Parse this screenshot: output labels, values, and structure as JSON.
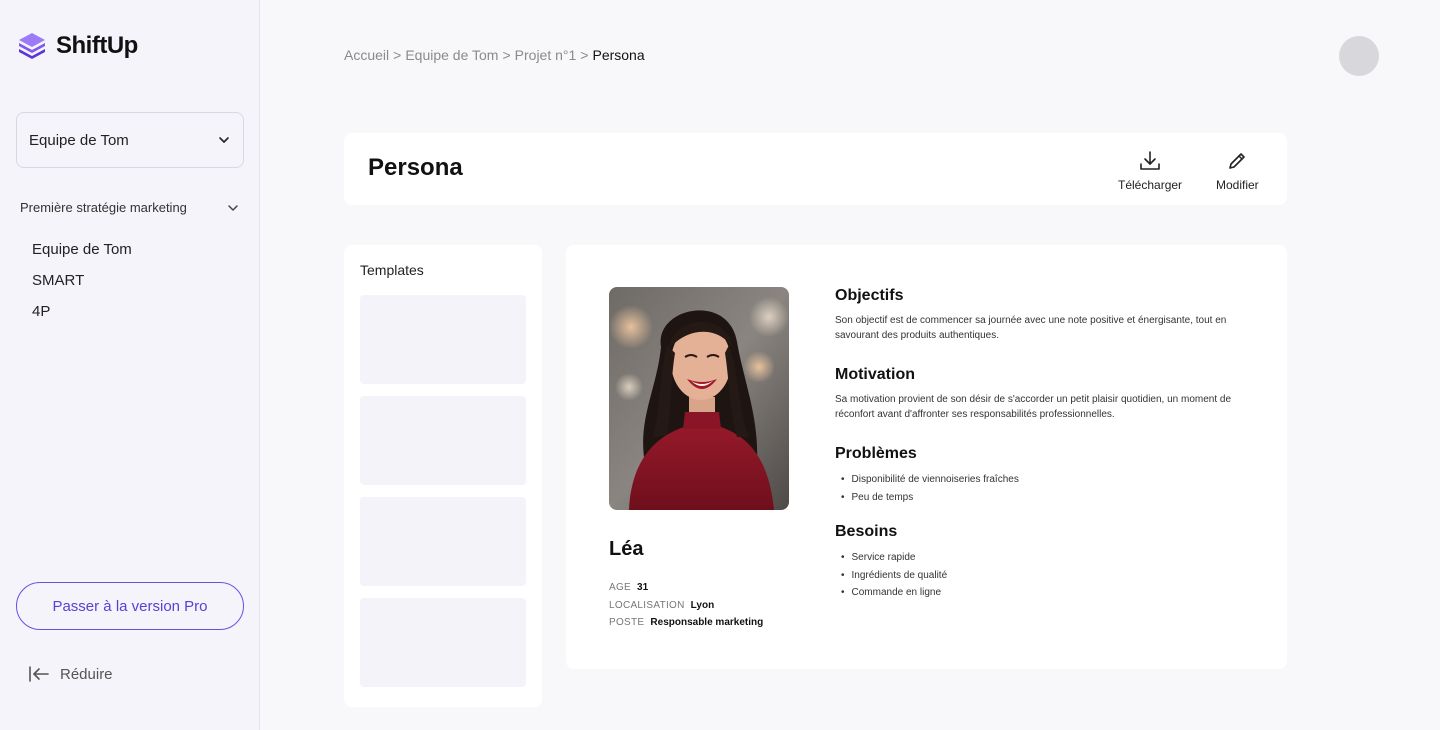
{
  "app": {
    "name": "ShiftUp"
  },
  "sidebar": {
    "team_select": "Equipe de Tom",
    "strategy": "Première stratégie marketing",
    "items": [
      {
        "label": "Equipe de Tom"
      },
      {
        "label": "SMART"
      },
      {
        "label": "4P"
      }
    ],
    "pro_button": "Passer à la version Pro",
    "reduce_label": "Réduire"
  },
  "breadcrumb": {
    "items": [
      "Accueil",
      "Equipe de Tom",
      "Projet n°1"
    ],
    "current": "Persona",
    "separator": ">"
  },
  "page": {
    "title": "Persona",
    "actions": {
      "download": "Télécharger",
      "edit": "Modifier"
    }
  },
  "templates": {
    "title": "Templates",
    "count": 4
  },
  "persona": {
    "name": "Léa",
    "facts": [
      {
        "key": "AGE",
        "value": "31"
      },
      {
        "key": "LOCALISATION",
        "value": "Lyon"
      },
      {
        "key": "POSTE",
        "value": "Responsable marketing"
      }
    ],
    "sections": {
      "objectifs": {
        "title": "Objectifs",
        "text": "Son objectif est de commencer sa journée avec une note positive et énergisante, tout en savourant des produits authentiques."
      },
      "motivation": {
        "title": "Motivation",
        "text": "Sa motivation provient de son désir de s'accorder un petit plaisir quotidien, un moment de réconfort avant d'affronter ses responsabilités professionnelles."
      },
      "problemes": {
        "title": "Problèmes",
        "items": [
          "Disponibilité de viennoiseries fraîches",
          "Peu de temps"
        ]
      },
      "besoins": {
        "title": "Besoins",
        "items": [
          "Service rapide",
          "Ingrédients de qualité",
          "Commande en ligne"
        ]
      }
    }
  },
  "colors": {
    "accent": "#6b4ee6",
    "sidebar_bg": "#f5f4fa",
    "page_bg": "#f8f8fb",
    "sweater": "#8e1524"
  }
}
